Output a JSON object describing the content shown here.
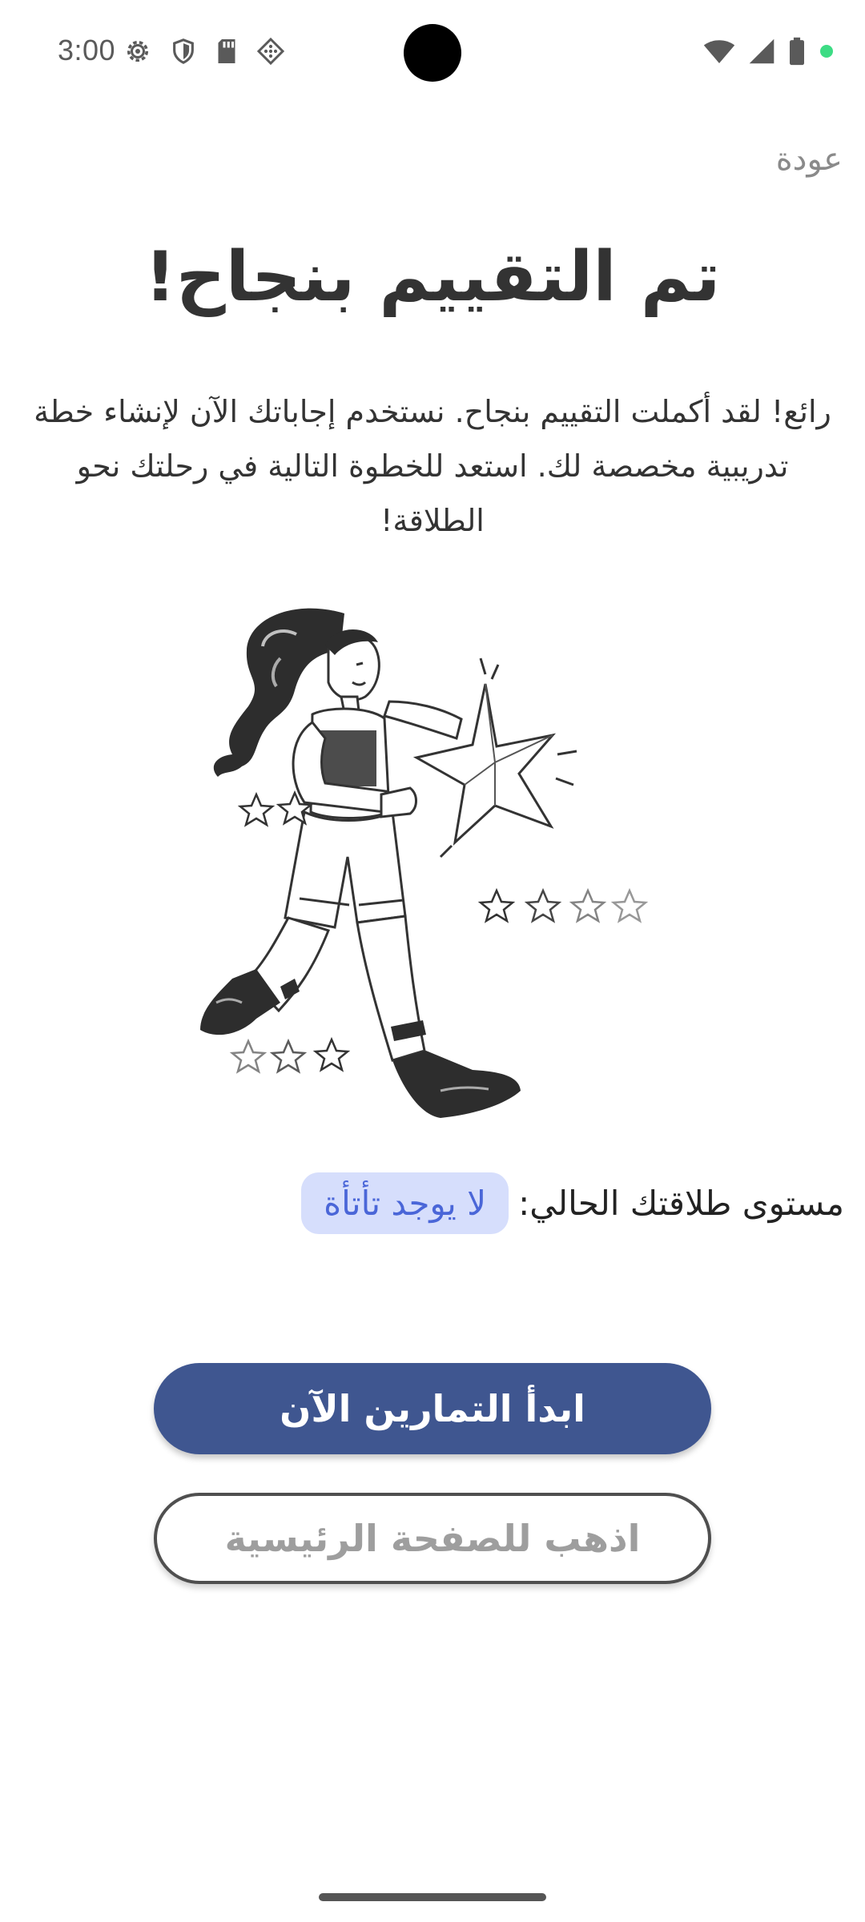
{
  "status_bar": {
    "time": "3:00",
    "left_icons": [
      "gear-icon",
      "shield-icon",
      "sd-card-icon",
      "dotted-diamond-icon"
    ],
    "right_icons": [
      "wifi-icon",
      "signal-icon",
      "battery-icon",
      "dot-icon"
    ],
    "dot_color": "#3ddc84"
  },
  "header": {
    "back_label": "عودة"
  },
  "main": {
    "title": "تم التقييم بنجاح!",
    "description": "رائع! لقد أكملت التقييم بنجاح. نستخدم إجاباتك الآن لإنشاء خطة تدريبية مخصصة لك. استعد للخطوة التالية في رحلتك نحو الطلاقة!",
    "illustration": "woman-running-holding-star-illustration",
    "level_label": "مستوى طلاقتك الحالي:",
    "level_value": "لا يوجد تأتأة"
  },
  "actions": {
    "primary_label": "ابدأ التمارين الآن",
    "secondary_label": "اذهب للصفحة الرئيسية"
  },
  "colors": {
    "primary": "#3f5690",
    "badge_bg": "#d6defc",
    "badge_text": "#4a66d8"
  }
}
